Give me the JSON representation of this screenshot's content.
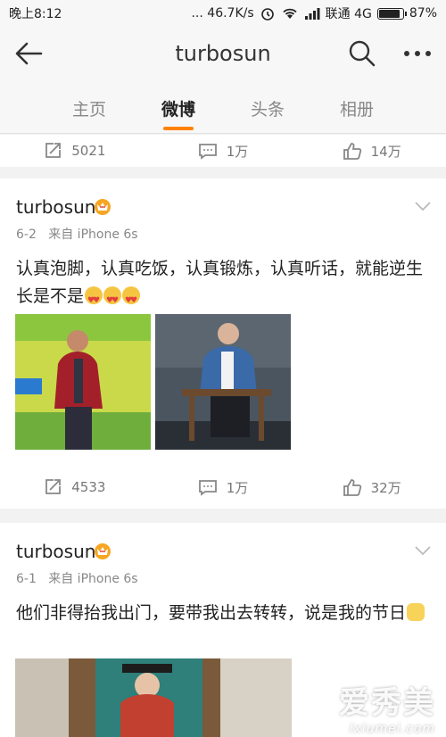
{
  "status_bar": {
    "time": "晚上8:12",
    "network_speed": "... 46.7K/s",
    "carrier": "联通 4G",
    "battery": "87%"
  },
  "nav": {
    "title": "turbosun",
    "icons": {
      "back": "back-arrow-icon",
      "search": "search-icon",
      "more": "more-icon"
    }
  },
  "tabs": [
    {
      "label": "主页"
    },
    {
      "label": "微博",
      "active": true
    },
    {
      "label": "头条"
    },
    {
      "label": "相册"
    }
  ],
  "colors": {
    "accent": "#ff8200",
    "background": "#f2f2f2"
  },
  "top_actions": {
    "repost": "5021",
    "comment": "1万",
    "like": "14万"
  },
  "posts": [
    {
      "author": "turbosun",
      "date": "6-2",
      "source": "来自 iPhone 6s",
      "text": "认真泡脚，认真吃饭，认真锻炼，认真听话，就能逆生长是不是",
      "emojis": [
        "heart-eyes-emoji",
        "heart-eyes-emoji",
        "heart-eyes-emoji"
      ],
      "actions": {
        "repost": "4533",
        "comment": "1万",
        "like": "32万"
      }
    },
    {
      "author": "turbosun",
      "date": "6-1",
      "source": "来自 iPhone 6s",
      "text": "他们非得抬我出门，要带我出去转转，说是我的节日",
      "emojis": [
        "cat-emoji"
      ]
    }
  ],
  "watermark": {
    "brand": "爱秀美",
    "domain": "ixiumei.com"
  }
}
